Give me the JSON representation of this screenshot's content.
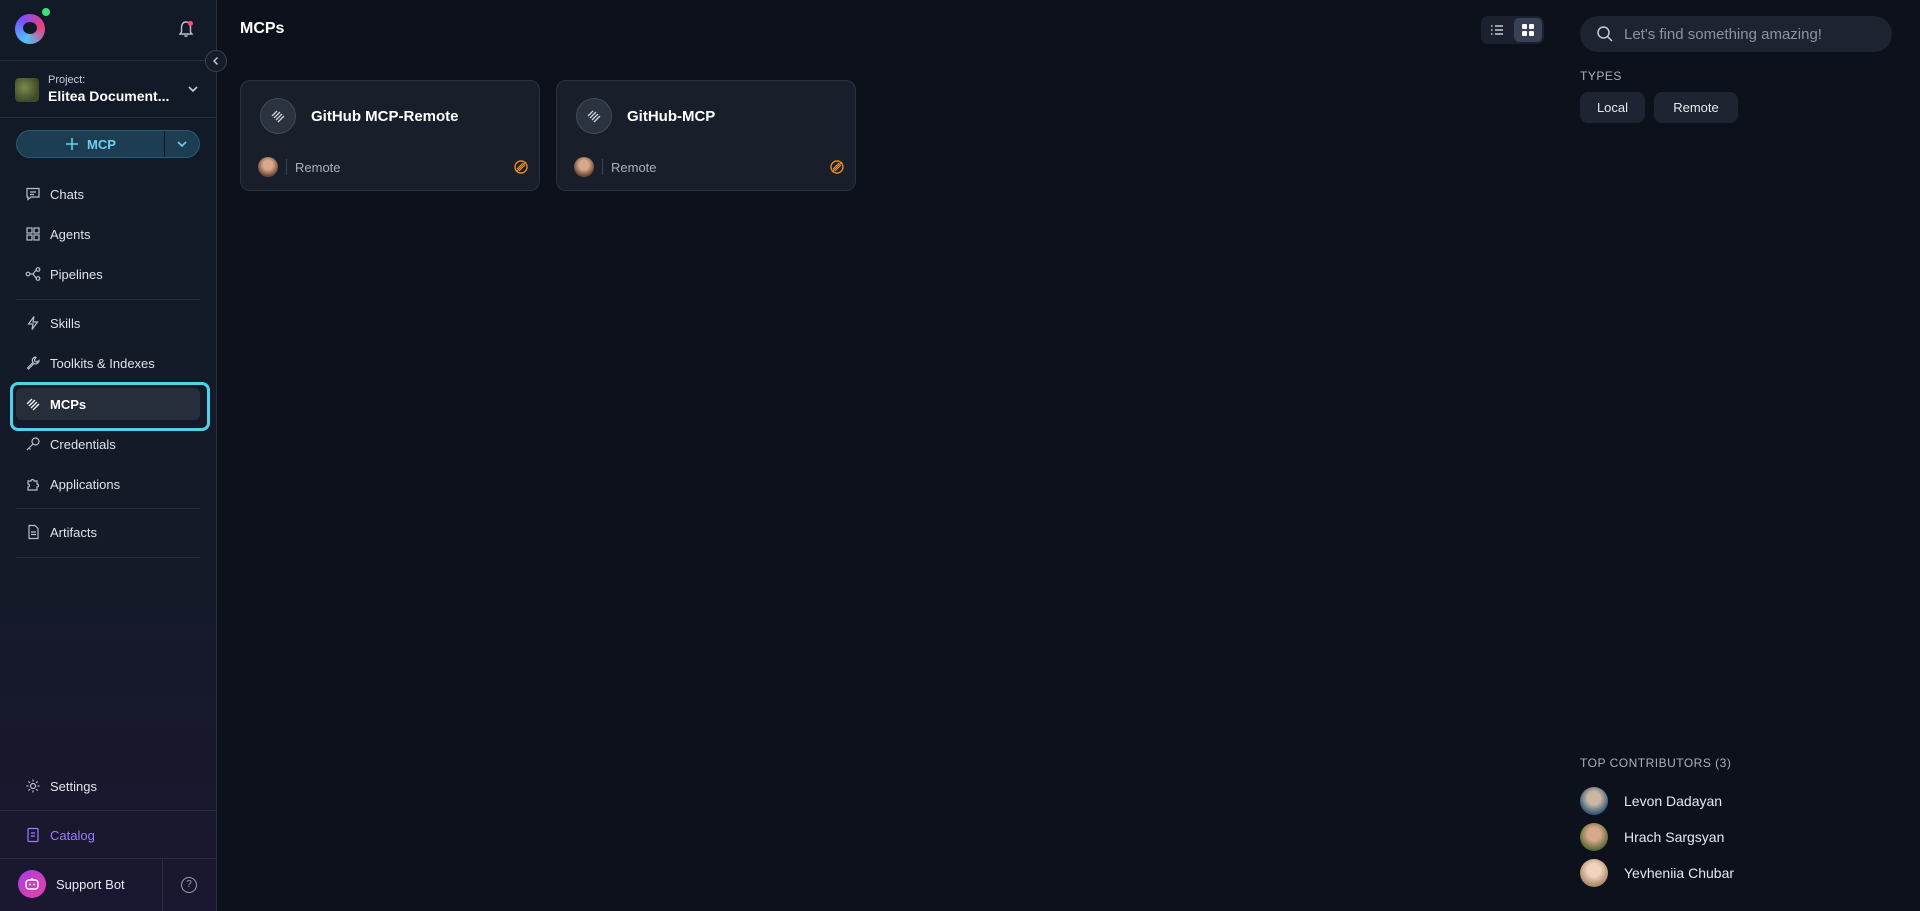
{
  "sidebar": {
    "project_label": "Project:",
    "project_name": "Elitea Document...",
    "mcp_button_label": "MCP",
    "nav_group1": [
      {
        "label": "Chats",
        "icon": "chat-icon"
      },
      {
        "label": "Agents",
        "icon": "grid-icon"
      },
      {
        "label": "Pipelines",
        "icon": "pipeline-icon"
      }
    ],
    "nav_group2": [
      {
        "label": "Skills",
        "icon": "bolt-icon"
      },
      {
        "label": "Toolkits & Indexes",
        "icon": "wrench-icon"
      },
      {
        "label": "MCPs",
        "icon": "mcp-icon",
        "active": true
      },
      {
        "label": "Credentials",
        "icon": "key-icon"
      },
      {
        "label": "Applications",
        "icon": "puzzle-icon"
      }
    ],
    "nav_group3": [
      {
        "label": "Artifacts",
        "icon": "file-icon"
      }
    ],
    "settings_label": "Settings",
    "catalog_label": "Catalog",
    "support_label": "Support Bot",
    "help_glyph": "?"
  },
  "main": {
    "title": "MCPs",
    "cards": [
      {
        "title": "GitHub MCP-Remote",
        "type": "Remote"
      },
      {
        "title": "GitHub-MCP",
        "type": "Remote"
      }
    ]
  },
  "right_panel": {
    "search_placeholder": "Let's find something amazing!",
    "types_title": "TYPES",
    "types": [
      "Local",
      "Remote"
    ],
    "contributors_title": "TOP CONTRIBUTORS (3)",
    "contributors": [
      "Levon Dadayan",
      "Hrach Sargsyan",
      "Yevheniia Chubar"
    ]
  },
  "colors": {
    "accent": "#4fd3ec",
    "catalog": "#9f7bff",
    "status_orange": "#e08a2e"
  }
}
